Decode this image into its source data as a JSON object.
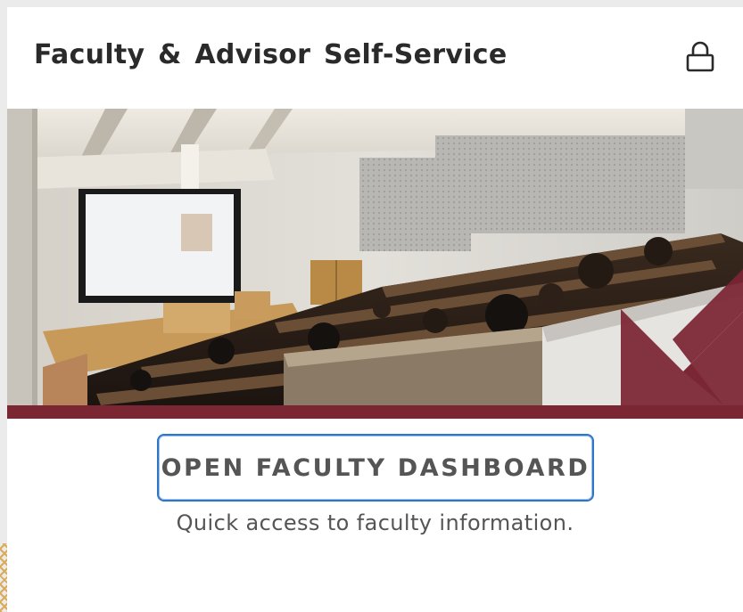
{
  "card": {
    "title": "Faculty & Advisor Self-Service",
    "header_icon": "lock-icon",
    "hero_image": "lecture-hall-photo",
    "hero_overlay_icon": "arrow-down-right-icon",
    "cta_label": "OPEN FACULTY DASHBOARD",
    "cta_caption": "Quick access to faculty information."
  },
  "colors": {
    "brand_maroon": "#7b2633",
    "button_border": "#2f75c9",
    "title_text": "#2a2a2a",
    "muted_text": "#555555",
    "page_background": "#ebebeb",
    "card_background": "#ffffff"
  }
}
